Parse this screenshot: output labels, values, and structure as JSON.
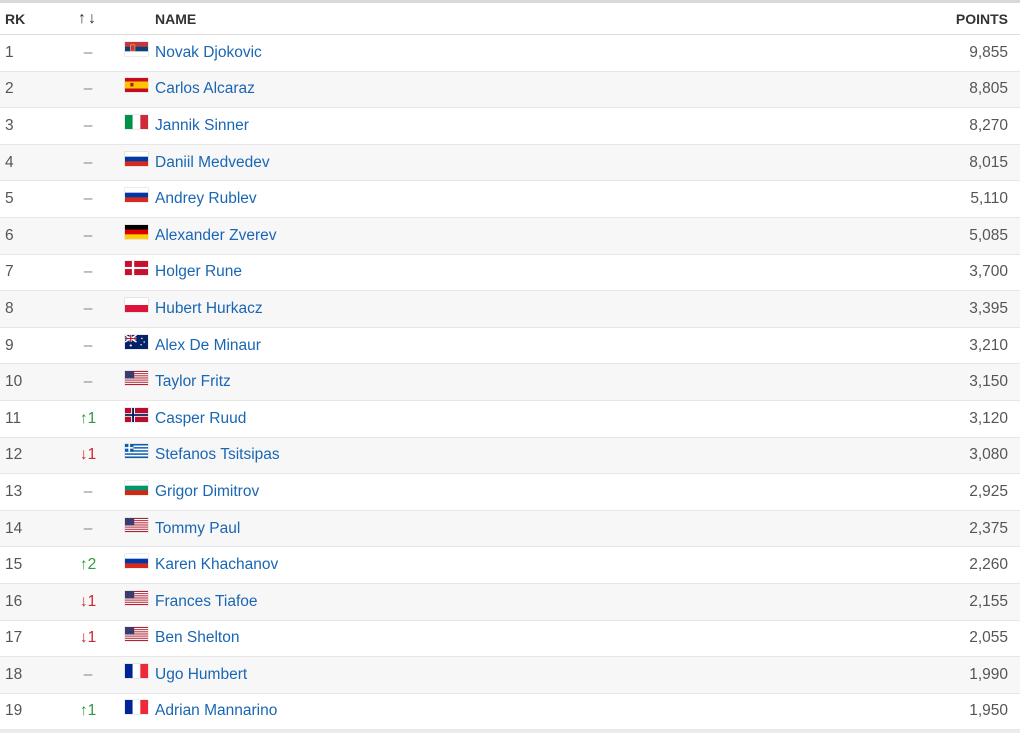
{
  "header": {
    "rank": "RK",
    "move": "↑↓",
    "name": "NAME",
    "points": "POINTS"
  },
  "rows": [
    {
      "rank": "1",
      "move": "–",
      "move_dir": "none",
      "flag": "SRB",
      "name": "Novak Djokovic",
      "points": "9,855"
    },
    {
      "rank": "2",
      "move": "–",
      "move_dir": "none",
      "flag": "ESP",
      "name": "Carlos Alcaraz",
      "points": "8,805"
    },
    {
      "rank": "3",
      "move": "–",
      "move_dir": "none",
      "flag": "ITA",
      "name": "Jannik Sinner",
      "points": "8,270"
    },
    {
      "rank": "4",
      "move": "–",
      "move_dir": "none",
      "flag": "RUS",
      "name": "Daniil Medvedev",
      "points": "8,015"
    },
    {
      "rank": "5",
      "move": "–",
      "move_dir": "none",
      "flag": "RUS",
      "name": "Andrey Rublev",
      "points": "5,110"
    },
    {
      "rank": "6",
      "move": "–",
      "move_dir": "none",
      "flag": "GER",
      "name": "Alexander Zverev",
      "points": "5,085"
    },
    {
      "rank": "7",
      "move": "–",
      "move_dir": "none",
      "flag": "DEN",
      "name": "Holger Rune",
      "points": "3,700"
    },
    {
      "rank": "8",
      "move": "–",
      "move_dir": "none",
      "flag": "POL",
      "name": "Hubert Hurkacz",
      "points": "3,395"
    },
    {
      "rank": "9",
      "move": "–",
      "move_dir": "none",
      "flag": "AUS",
      "name": "Alex De Minaur",
      "points": "3,210"
    },
    {
      "rank": "10",
      "move": "–",
      "move_dir": "none",
      "flag": "USA",
      "name": "Taylor Fritz",
      "points": "3,150"
    },
    {
      "rank": "11",
      "move": "↑1",
      "move_dir": "up",
      "flag": "NOR",
      "name": "Casper Ruud",
      "points": "3,120"
    },
    {
      "rank": "12",
      "move": "↓1",
      "move_dir": "down",
      "flag": "GRE",
      "name": "Stefanos Tsitsipas",
      "points": "3,080"
    },
    {
      "rank": "13",
      "move": "–",
      "move_dir": "none",
      "flag": "BUL",
      "name": "Grigor Dimitrov",
      "points": "2,925"
    },
    {
      "rank": "14",
      "move": "–",
      "move_dir": "none",
      "flag": "USA",
      "name": "Tommy Paul",
      "points": "2,375"
    },
    {
      "rank": "15",
      "move": "↑2",
      "move_dir": "up",
      "flag": "RUS",
      "name": "Karen Khachanov",
      "points": "2,260"
    },
    {
      "rank": "16",
      "move": "↓1",
      "move_dir": "down",
      "flag": "USA",
      "name": "Frances Tiafoe",
      "points": "2,155"
    },
    {
      "rank": "17",
      "move": "↓1",
      "move_dir": "down",
      "flag": "USA",
      "name": "Ben Shelton",
      "points": "2,055"
    },
    {
      "rank": "18",
      "move": "–",
      "move_dir": "none",
      "flag": "FRA",
      "name": "Ugo Humbert",
      "points": "1,990"
    },
    {
      "rank": "19",
      "move": "↑1",
      "move_dir": "up",
      "flag": "FRA",
      "name": "Adrian Mannarino",
      "points": "1,950"
    }
  ],
  "colors": {
    "link": "#1a66b3",
    "up": "#2e9a43",
    "down": "#d0242f",
    "stripe": "#f7f7f7"
  }
}
